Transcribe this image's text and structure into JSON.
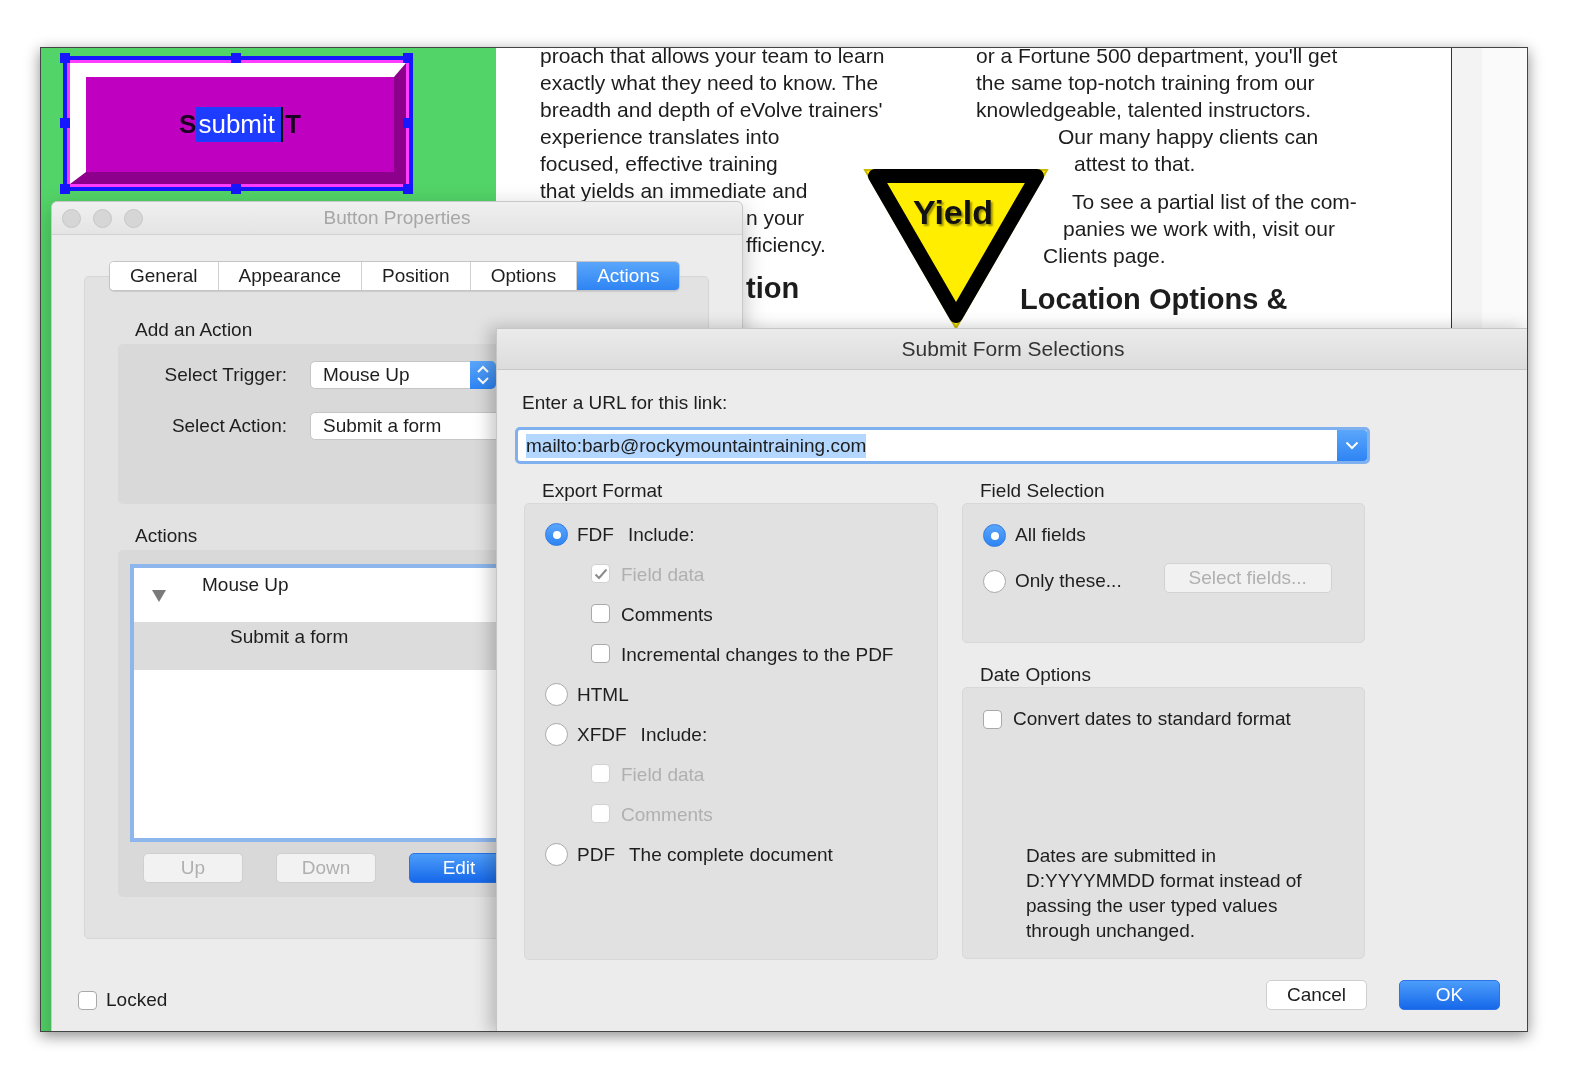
{
  "form_button": {
    "text_before": "S",
    "selected_text": "submit",
    "text_after": "T"
  },
  "document": {
    "column_1": {
      "lines": [
        "proach that allows your team to learn",
        "exactly what they need to know. The",
        "breadth and depth of eVolve trainers'",
        "experience translates into",
        "focused, effective training",
        "that yields an immediate and"
      ],
      "partly_covered_lines": [
        "n your",
        "fficiency."
      ],
      "heading": "tion"
    },
    "sign": {
      "text": "Yield"
    },
    "column_2": {
      "paragraphs": [
        [
          "or a Fortune 500 department, you'll get",
          "the same top-notch training from our",
          "knowledgeable, talented instructors.",
          "Our many happy clients can",
          "attest to that."
        ],
        [
          "To see a partial list of the com-",
          "panies we work with, visit our",
          "Clients page."
        ]
      ],
      "heading": "Location Options &"
    }
  },
  "button_properties": {
    "title": "Button Properties",
    "tabs": [
      {
        "label": "General",
        "selected": false
      },
      {
        "label": "Appearance",
        "selected": false
      },
      {
        "label": "Position",
        "selected": false
      },
      {
        "label": "Options",
        "selected": false
      },
      {
        "label": "Actions",
        "selected": true
      }
    ],
    "add_action": {
      "heading": "Add an Action",
      "trigger_label": "Select Trigger:",
      "trigger": "Mouse Up",
      "action_label": "Select Action:",
      "action": "Submit a form"
    },
    "actions": {
      "heading": "Actions",
      "tree": [
        {
          "label": "Mouse Up",
          "expanded": true,
          "children": [
            {
              "label": "Submit a form",
              "selected": true
            }
          ]
        }
      ],
      "buttons": [
        {
          "label": "Up",
          "disabled": true,
          "default": false
        },
        {
          "label": "Down",
          "disabled": true,
          "default": false
        },
        {
          "label": "Edit",
          "disabled": false,
          "default": true
        }
      ]
    },
    "locked": {
      "label": "Locked",
      "checked": false
    }
  },
  "submit_form": {
    "title": "Submit Form Selections",
    "url_label": "Enter a URL for this link:",
    "url": "mailto:barb@rockymountaintraining.com",
    "export_format": {
      "heading": "Export Format",
      "options": [
        {
          "label": "FDF",
          "note": "Include:",
          "selected": true,
          "children": [
            {
              "label": "Field data",
              "checked": true,
              "disabled": true
            },
            {
              "label": "Comments",
              "checked": false,
              "disabled": false
            },
            {
              "label": "Incremental changes to the PDF",
              "checked": false,
              "disabled": false
            }
          ]
        },
        {
          "label": "HTML",
          "selected": false
        },
        {
          "label": "XFDF",
          "note": "Include:",
          "selected": false,
          "children": [
            {
              "label": "Field data",
              "checked": false,
              "disabled": true
            },
            {
              "label": "Comments",
              "checked": false,
              "disabled": true
            }
          ]
        },
        {
          "label": "PDF",
          "note": "The complete document",
          "selected": false
        }
      ]
    },
    "field_selection": {
      "heading": "Field Selection",
      "options": [
        {
          "label": "All fields",
          "selected": true
        },
        {
          "label": "Only these...",
          "selected": false
        }
      ],
      "select_button": {
        "label": "Select fields...",
        "disabled": true
      }
    },
    "date_options": {
      "heading": "Date Options",
      "convert": {
        "label": "Convert dates to standard format",
        "checked": false
      },
      "note": "Dates are submitted in D:YYYYMMDD format instead of passing the user typed values through unchanged."
    },
    "buttons": [
      {
        "label": "Cancel",
        "default": false
      },
      {
        "label": "OK",
        "default": true
      }
    ]
  }
}
